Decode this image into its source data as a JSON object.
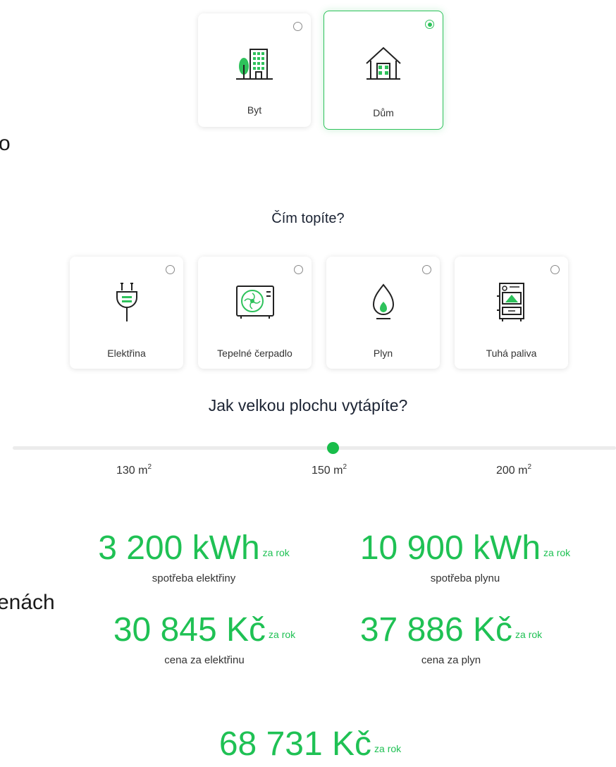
{
  "property": {
    "options": [
      {
        "label": "Byt",
        "selected": false,
        "icon": "apartment-building-icon"
      },
      {
        "label": "Dům",
        "selected": true,
        "icon": "house-icon"
      }
    ]
  },
  "partial_text": {
    "left_1": "o",
    "left_2": "enách"
  },
  "heating": {
    "question": "Čím topíte?",
    "options": [
      {
        "label": "Elektřina",
        "selected": false,
        "icon": "electric-plug-icon"
      },
      {
        "label": "Tepelné čerpadlo",
        "selected": false,
        "icon": "heat-pump-icon"
      },
      {
        "label": "Plyn",
        "selected": false,
        "icon": "gas-flame-icon"
      },
      {
        "label": "Tuhá paliva",
        "selected": false,
        "icon": "solid-fuel-boiler-icon"
      }
    ]
  },
  "area": {
    "question": "Jak velkou plochu vytápíte?",
    "ticks": [
      {
        "value": "130 m",
        "unit_sup": "2"
      },
      {
        "value": "150 m",
        "unit_sup": "2"
      },
      {
        "value": "200 m",
        "unit_sup": "2"
      }
    ],
    "selected": "150"
  },
  "results": {
    "electricity_consumption": {
      "value": "3 200 kWh",
      "period": "za rok",
      "label": "spotřeba elektřiny"
    },
    "gas_consumption": {
      "value": "10 900 kWh",
      "period": "za rok",
      "label": "spotřeba plynu"
    },
    "electricity_price": {
      "value": "30 845 Kč",
      "period": "za rok",
      "label": "cena za elektřinu"
    },
    "gas_price": {
      "value": "37 886 Kč",
      "period": "za rok",
      "label": "cena za plyn"
    },
    "total_price": {
      "value": "68 731 Kč",
      "period": "za rok"
    }
  },
  "colors": {
    "accent": "#1fc154",
    "text": "#1b2333"
  }
}
